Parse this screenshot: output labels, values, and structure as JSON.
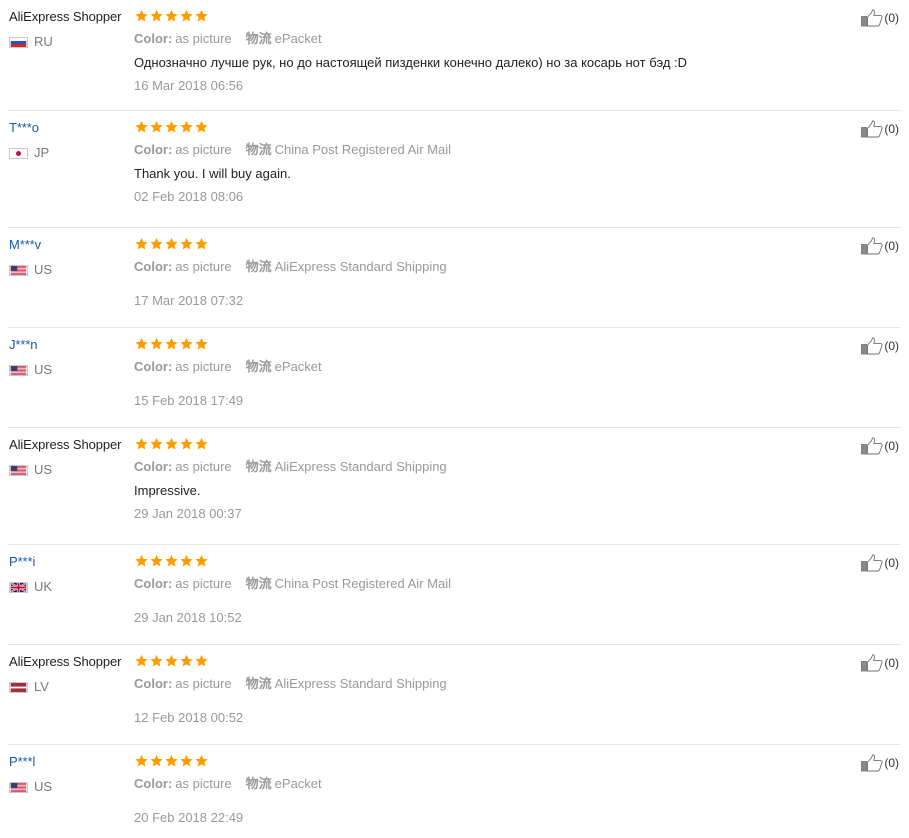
{
  "colors": {
    "star": "#ff9d00",
    "masked_name": "#1a5aa8",
    "muted_text": "#999999",
    "divider": "#e8e8e8"
  },
  "reviews": [
    {
      "name": "AliExpress Shopper",
      "country": "RU",
      "flag": "ru",
      "rating": 5,
      "color_label": "Color:",
      "color_value": "as picture",
      "logistics_label": "物流",
      "logistics_value": "ePacket",
      "comment": "Однозначно лучше рук, но до настоящей пизденки конечно далеко) но за косарь нот бэд :D",
      "date": "16 Mar 2018 06:56",
      "helpful": "(0)"
    },
    {
      "name": "T***o",
      "country": "JP",
      "flag": "jp",
      "rating": 5,
      "color_label": "Color:",
      "color_value": "as picture",
      "logistics_label": "物流",
      "logistics_value": "China Post Registered Air Mail",
      "comment": "Thank you. I will buy again.",
      "date": "02 Feb 2018 08:06",
      "helpful": "(0)"
    },
    {
      "name": "M***v",
      "country": "US",
      "flag": "us",
      "rating": 5,
      "color_label": "Color:",
      "color_value": "as picture",
      "logistics_label": "物流",
      "logistics_value": "AliExpress Standard Shipping",
      "comment": "",
      "date": "17 Mar 2018 07:32",
      "helpful": "(0)"
    },
    {
      "name": "J***n",
      "country": "US",
      "flag": "us",
      "rating": 5,
      "color_label": "Color:",
      "color_value": "as picture",
      "logistics_label": "物流",
      "logistics_value": "ePacket",
      "comment": "",
      "date": "15 Feb 2018 17:49",
      "helpful": "(0)"
    },
    {
      "name": "AliExpress Shopper",
      "country": "US",
      "flag": "us",
      "rating": 5,
      "color_label": "Color:",
      "color_value": "as picture",
      "logistics_label": "物流",
      "logistics_value": "AliExpress Standard Shipping",
      "comment": "Impressive.",
      "date": "29 Jan 2018 00:37",
      "helpful": "(0)"
    },
    {
      "name": "P***i",
      "country": "UK",
      "flag": "uk",
      "rating": 5,
      "color_label": "Color:",
      "color_value": "as picture",
      "logistics_label": "物流",
      "logistics_value": "China Post Registered Air Mail",
      "comment": "",
      "date": "29 Jan 2018 10:52",
      "helpful": "(0)"
    },
    {
      "name": "AliExpress Shopper",
      "country": "LV",
      "flag": "lv",
      "rating": 5,
      "color_label": "Color:",
      "color_value": "as picture",
      "logistics_label": "物流",
      "logistics_value": "AliExpress Standard Shipping",
      "comment": "",
      "date": "12 Feb 2018 00:52",
      "helpful": "(0)"
    },
    {
      "name": "P***l",
      "country": "US",
      "flag": "us",
      "rating": 5,
      "color_label": "Color:",
      "color_value": "as picture",
      "logistics_label": "物流",
      "logistics_value": "ePacket",
      "comment": "",
      "date": "20 Feb 2018 22:49",
      "helpful": "(0)"
    }
  ]
}
